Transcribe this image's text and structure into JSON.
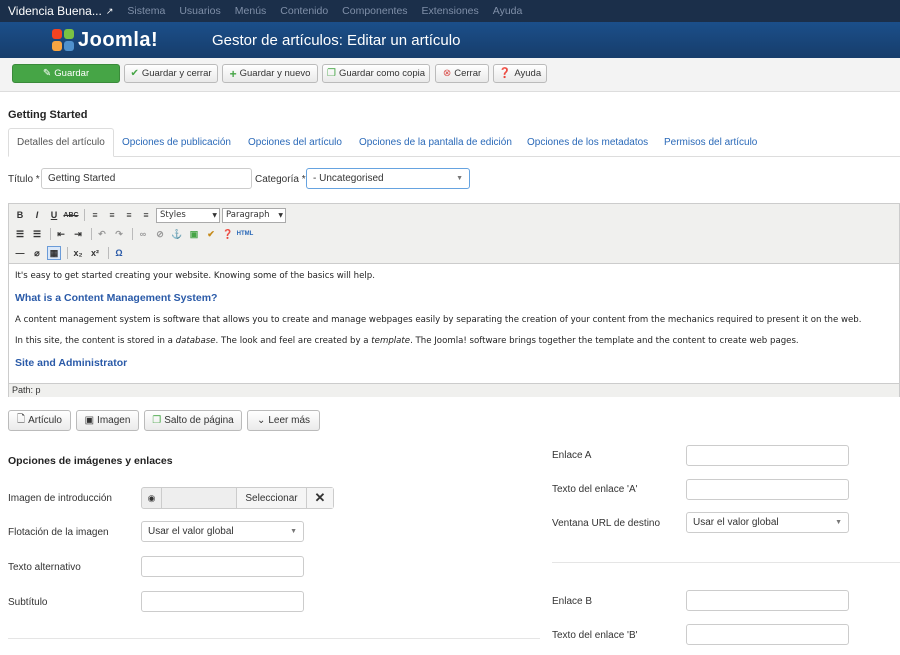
{
  "topnav": {
    "site_name": "Videncia Buena...",
    "menu": [
      "Sistema",
      "Usuarios",
      "Menús",
      "Contenido",
      "Componentes",
      "Extensiones",
      "Ayuda"
    ]
  },
  "header": {
    "logo_text": "Joomla!",
    "page_title": "Gestor de artículos: Editar un artículo"
  },
  "toolbar": {
    "save": "Guardar",
    "save_close": "Guardar y cerrar",
    "save_new": "Guardar y nuevo",
    "save_copy": "Guardar como copia",
    "close": "Cerrar",
    "help": "Ayuda"
  },
  "article_heading": "Getting Started",
  "tabs": [
    "Detalles del artículo",
    "Opciones de publicación",
    "Opciones del artículo",
    "Opciones de la pantalla de edición",
    "Opciones de los metadatos",
    "Permisos del artículo"
  ],
  "form": {
    "title_label": "Título *",
    "title_value": "Getting Started",
    "category_label": "Categoría *",
    "category_value": "- Uncategorised"
  },
  "editor": {
    "styles": "Styles",
    "format": "Paragraph",
    "p1": "It's easy to get started creating your website. Knowing some of the basics will help.",
    "h1": "What is a Content Management System?",
    "p2": "A content management system is software that allows you to create and manage webpages easily by separating the creation of your content from the mechanics required to present it on the web.",
    "p3_a": "In this site, the content is stored in a ",
    "p3_b": "database",
    "p3_c": ". The look and feel are created by a ",
    "p3_d": "template",
    "p3_e": ". The Joomla! software brings together the template and the content to create web pages.",
    "h2": "Site and Administrator",
    "path": "Path: p"
  },
  "editor_buttons": {
    "article": "Artículo",
    "image": "Imagen",
    "pagebreak": "Salto de página",
    "readmore": "Leer más"
  },
  "images_section": {
    "title": "Opciones de imágenes y enlaces",
    "intro_image_label": "Imagen de introducción",
    "select_label": "Seleccionar",
    "float_label": "Flotación de la imagen",
    "float_value": "Usar el valor global",
    "alt_label": "Texto alternativo",
    "caption_label": "Subtítulo"
  },
  "links_section": {
    "link_a_label": "Enlace A",
    "link_a_text_label": "Texto del enlace 'A'",
    "target_label": "Ventana URL de destino",
    "target_value": "Usar el valor global",
    "link_b_label": "Enlace B",
    "link_b_text_label": "Texto del enlace 'B'"
  }
}
